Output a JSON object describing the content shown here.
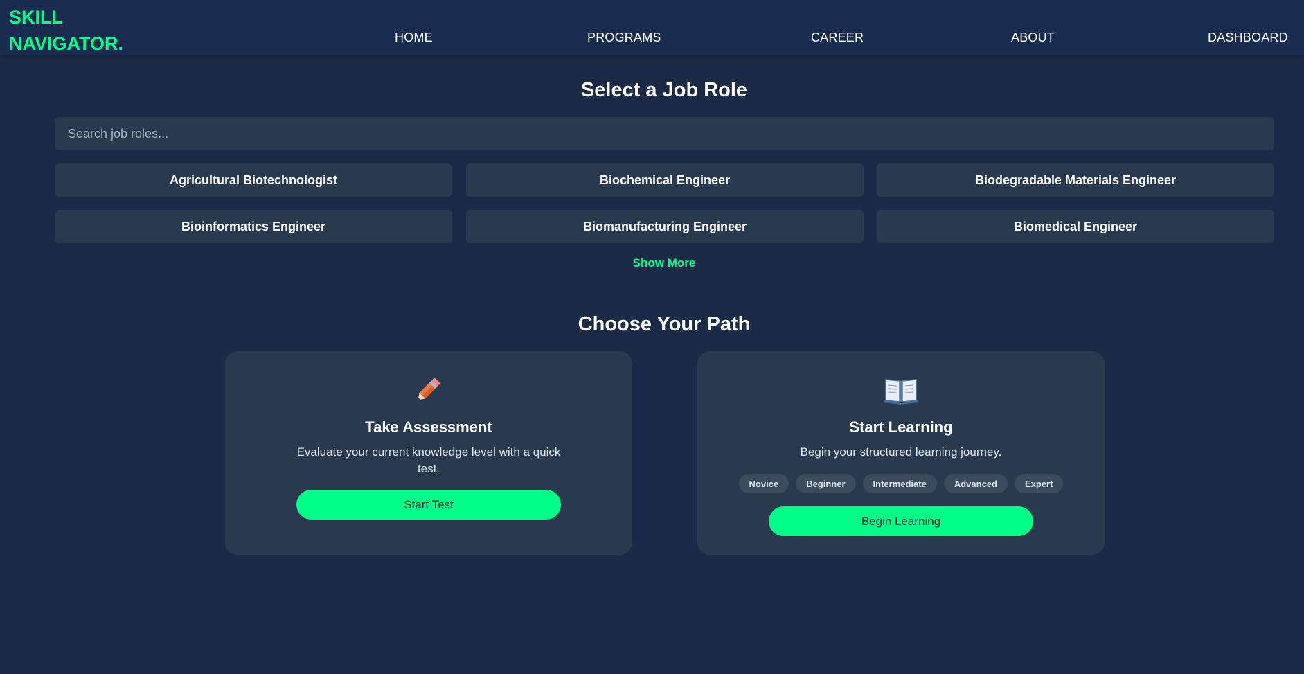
{
  "brand": {
    "line1": "SKILL",
    "line2": "NAVIGATOR."
  },
  "nav": {
    "home": "HOME",
    "programs": "PROGRAMS",
    "career": "CAREER",
    "about": "ABOUT",
    "dashboard": "DASHBOARD"
  },
  "job_section": {
    "title": "Select a Job Role",
    "search_placeholder": "Search job roles...",
    "roles": [
      "Agricultural Biotechnologist",
      "Biochemical Engineer",
      "Biodegradable Materials Engineer",
      "Bioinformatics Engineer",
      "Biomanufacturing Engineer",
      "Biomedical Engineer"
    ],
    "show_more": "Show More"
  },
  "path_section": {
    "title": "Choose Your Path",
    "assessment": {
      "icon": "pencil-icon",
      "title": "Take Assessment",
      "description": "Evaluate your current knowledge level with a quick test.",
      "button": "Start Test"
    },
    "learning": {
      "icon": "open-book-icon",
      "title": "Start Learning",
      "description": "Begin your structured learning journey.",
      "levels": [
        "Novice",
        "Beginner",
        "Intermediate",
        "Advanced",
        "Expert"
      ],
      "button": "Begin Learning"
    }
  },
  "colors": {
    "accent": "#00ff88",
    "background": "#1b2a47",
    "navbar": "#192c50",
    "card": "#2a3a4e"
  }
}
